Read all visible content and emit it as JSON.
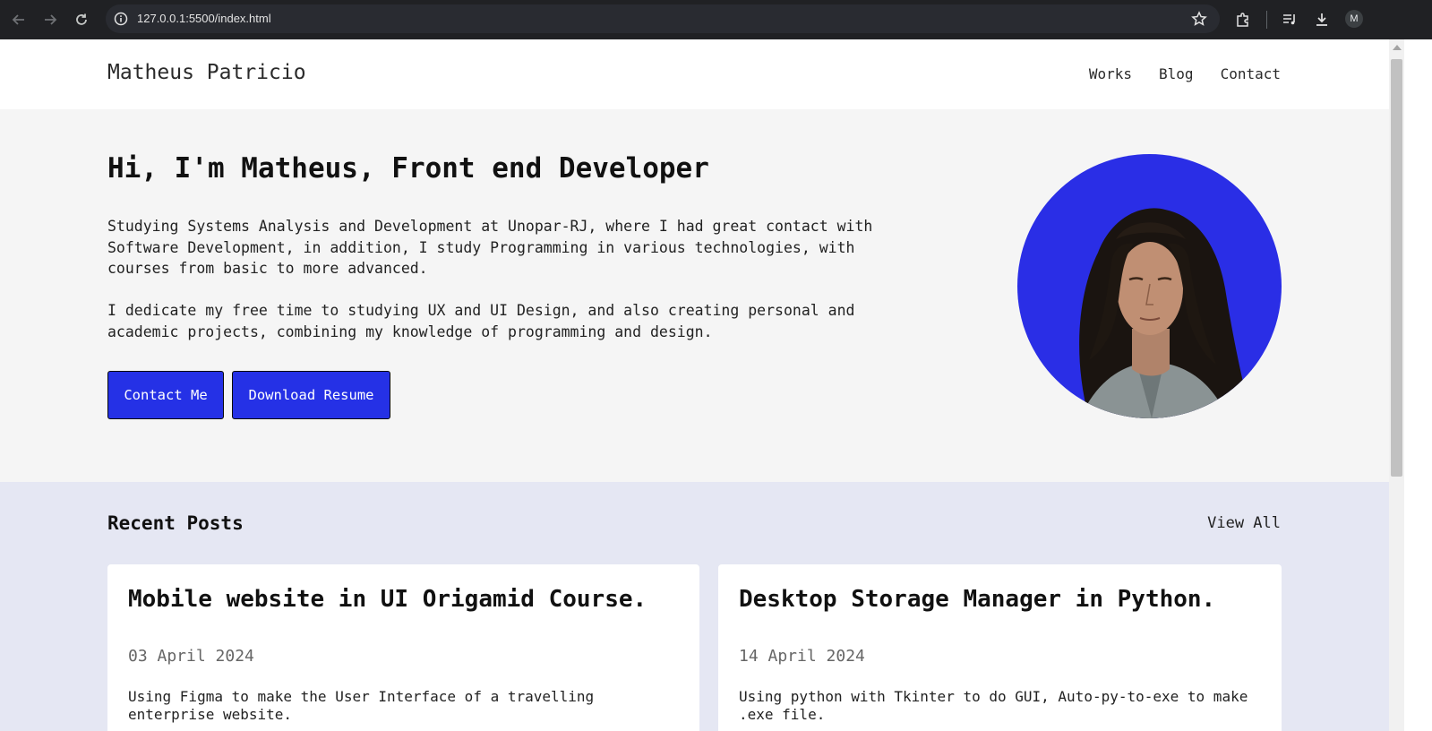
{
  "browser": {
    "url": "127.0.0.1:5500/index.html",
    "profile_initial": "M"
  },
  "site": {
    "brand": "Matheus Patricio",
    "nav": [
      "Works",
      "Blog",
      "Contact"
    ]
  },
  "hero": {
    "heading": "Hi, I'm Matheus, Front end Developer",
    "paragraph1": "Studying Systems Analysis and Development at Unopar-RJ, where I had great contact with Software Development, in addition, I study Programming in various technologies, with courses from basic to more advanced.",
    "paragraph2": "I dedicate my free time to studying UX and UI Design, and also creating personal and academic projects, combining my knowledge of programming and design.",
    "contact_button": "Contact Me",
    "resume_button": "Download Resume"
  },
  "recent_posts": {
    "title": "Recent Posts",
    "view_all": "View All",
    "posts": [
      {
        "title": "Mobile website in UI Origamid Course.",
        "date": "03 April 2024",
        "description": "Using Figma to make the User Interface of a travelling enterprise website."
      },
      {
        "title": "Desktop Storage Manager in Python.",
        "date": "14 April 2024",
        "description": "Using python with Tkinter to do GUI, Auto-py-to-exe to make .exe file."
      }
    ]
  },
  "colors": {
    "accent": "#2531e6",
    "hero_bg": "#f5f5f5",
    "posts_bg": "#e5e7f3",
    "chrome_bg": "#202124"
  }
}
